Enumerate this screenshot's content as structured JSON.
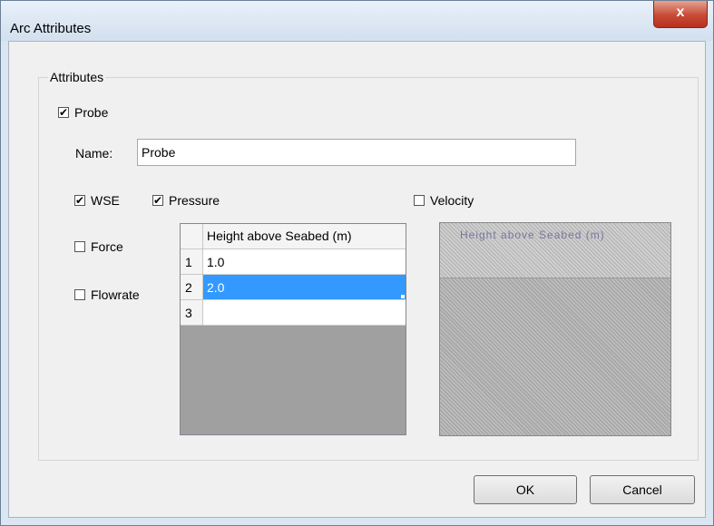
{
  "window": {
    "title": "Arc Attributes",
    "close_glyph": "x"
  },
  "attributes_group": {
    "legend": "Attributes",
    "probe": {
      "label": "Probe",
      "checked": true
    },
    "name": {
      "label": "Name:",
      "value": "Probe"
    },
    "wse": {
      "label": "WSE",
      "checked": true
    },
    "pressure": {
      "label": "Pressure",
      "checked": true
    },
    "velocity": {
      "label": "Velocity",
      "checked": false
    },
    "force": {
      "label": "Force",
      "checked": false
    },
    "flowrate": {
      "label": "Flowrate",
      "checked": false
    },
    "height_grid": {
      "column_header": "Height above Seabed (m)",
      "rows": [
        {
          "num": "1",
          "value": "1.0",
          "selected": false
        },
        {
          "num": "2",
          "value": "2.0",
          "selected": true
        },
        {
          "num": "3",
          "value": "",
          "selected": false
        }
      ]
    },
    "velocity_grid": {
      "header_text": "Height above Seabed (m)"
    }
  },
  "buttons": {
    "ok": "OK",
    "cancel": "Cancel"
  },
  "colors": {
    "selection": "#3399ff",
    "close_button": "#c74a35"
  }
}
